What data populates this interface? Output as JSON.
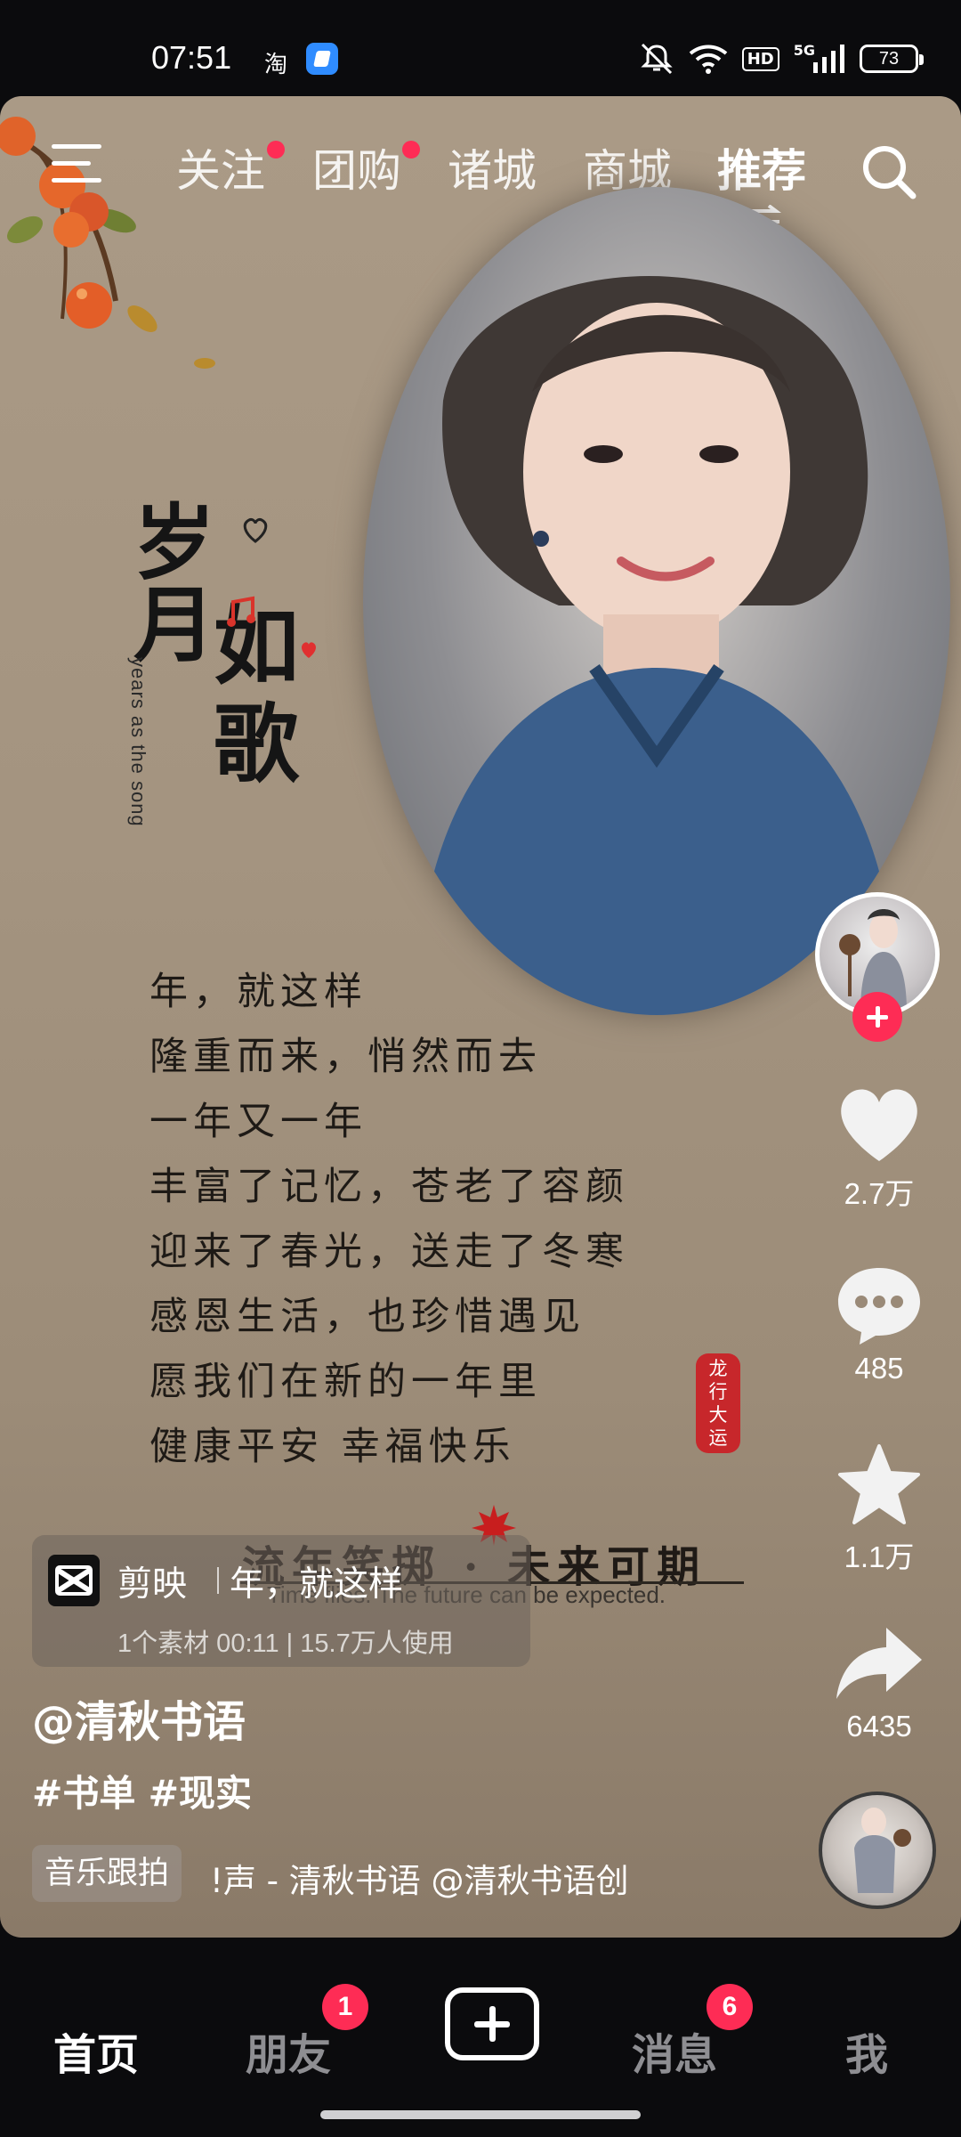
{
  "status_bar": {
    "time": "07:51",
    "left_app_label": "淘",
    "network_label": "HD",
    "signal_label": "5G",
    "battery_level": "73"
  },
  "top_nav": {
    "tabs": [
      {
        "label": "关注",
        "has_dot": true
      },
      {
        "label": "团购",
        "has_dot": true
      },
      {
        "label": "诸城",
        "has_dot": false
      },
      {
        "label": "商城",
        "has_dot": false
      },
      {
        "label": "推荐",
        "active": true
      }
    ],
    "icons": {
      "menu": "menu-icon",
      "search": "search-icon",
      "swap": "swap-icon"
    }
  },
  "video": {
    "title_chars": [
      "岁",
      "月",
      "如",
      "歌"
    ],
    "title_en": "years as the song",
    "poem_lines": [
      "年，就这样",
      "隆重而来，悄然而去",
      "一年又一年",
      "丰富了记忆，苍老了容颜",
      "迎来了春光，送走了冬寒",
      "感恩生活，也珍惜遇见",
      "愿我们在新的一年里",
      "健康平安 幸福快乐"
    ],
    "seal_text": "龙行大运",
    "slogan_cn": "流年笑掷 · 未来可期",
    "slogan_en": "Time flies. The future can be expected."
  },
  "right_rail": {
    "like_count": "2.7万",
    "comment_count": "485",
    "favorite_count": "1.1万",
    "share_count": "6435"
  },
  "template_card": {
    "app_name": "剪映",
    "template_name": "年，就这样",
    "meta": "1个素材 00:11 | 15.7万人使用"
  },
  "caption": {
    "author": "@清秋书语",
    "tags": "#书单 #现实",
    "music_badge": "音乐跟拍",
    "music_text": "!声 - 清秋书语    @清秋书语创"
  },
  "tab_bar": {
    "tabs": [
      {
        "label": "首页",
        "active": true
      },
      {
        "label": "朋友",
        "badge": "1"
      },
      {
        "label": "消息",
        "badge": "6"
      },
      {
        "label": "我"
      }
    ]
  },
  "colors": {
    "accent": "#fe2c55",
    "background": "#0b0b0d"
  }
}
